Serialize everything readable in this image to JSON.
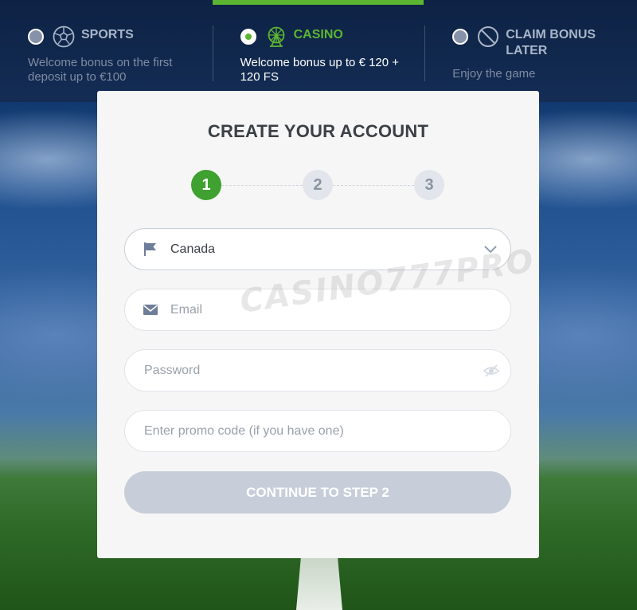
{
  "bonus_options": [
    {
      "title": "SPORTS",
      "description": "Welcome bonus on the first deposit up to €100",
      "icon": "soccer-ball-icon",
      "selected": false
    },
    {
      "title": "CASINO",
      "description": "Welcome bonus up to € 120 + 120 FS",
      "icon": "ferris-wheel-icon",
      "selected": true
    },
    {
      "title": "CLAIM BONUS LATER",
      "description": "Enjoy the game",
      "icon": "no-sign-icon",
      "selected": false
    }
  ],
  "form": {
    "title": "CREATE YOUR ACCOUNT",
    "steps": [
      "1",
      "2",
      "3"
    ],
    "active_step": 1,
    "country": {
      "value": "Canada",
      "icon": "flag-icon"
    },
    "email": {
      "placeholder": "Email",
      "icon": "envelope-icon"
    },
    "password": {
      "placeholder": "Password",
      "icon": "eye-off-icon"
    },
    "promo": {
      "placeholder": "Enter promo code (if you have one)"
    },
    "continue_label": "CONTINUE TO STEP 2"
  },
  "watermark": "CASINO777PRO",
  "colors": {
    "accent_green": "#5cb531",
    "step_active": "#3fa12f",
    "button_disabled": "#c7ced9",
    "header_bg": "#0d2244"
  }
}
